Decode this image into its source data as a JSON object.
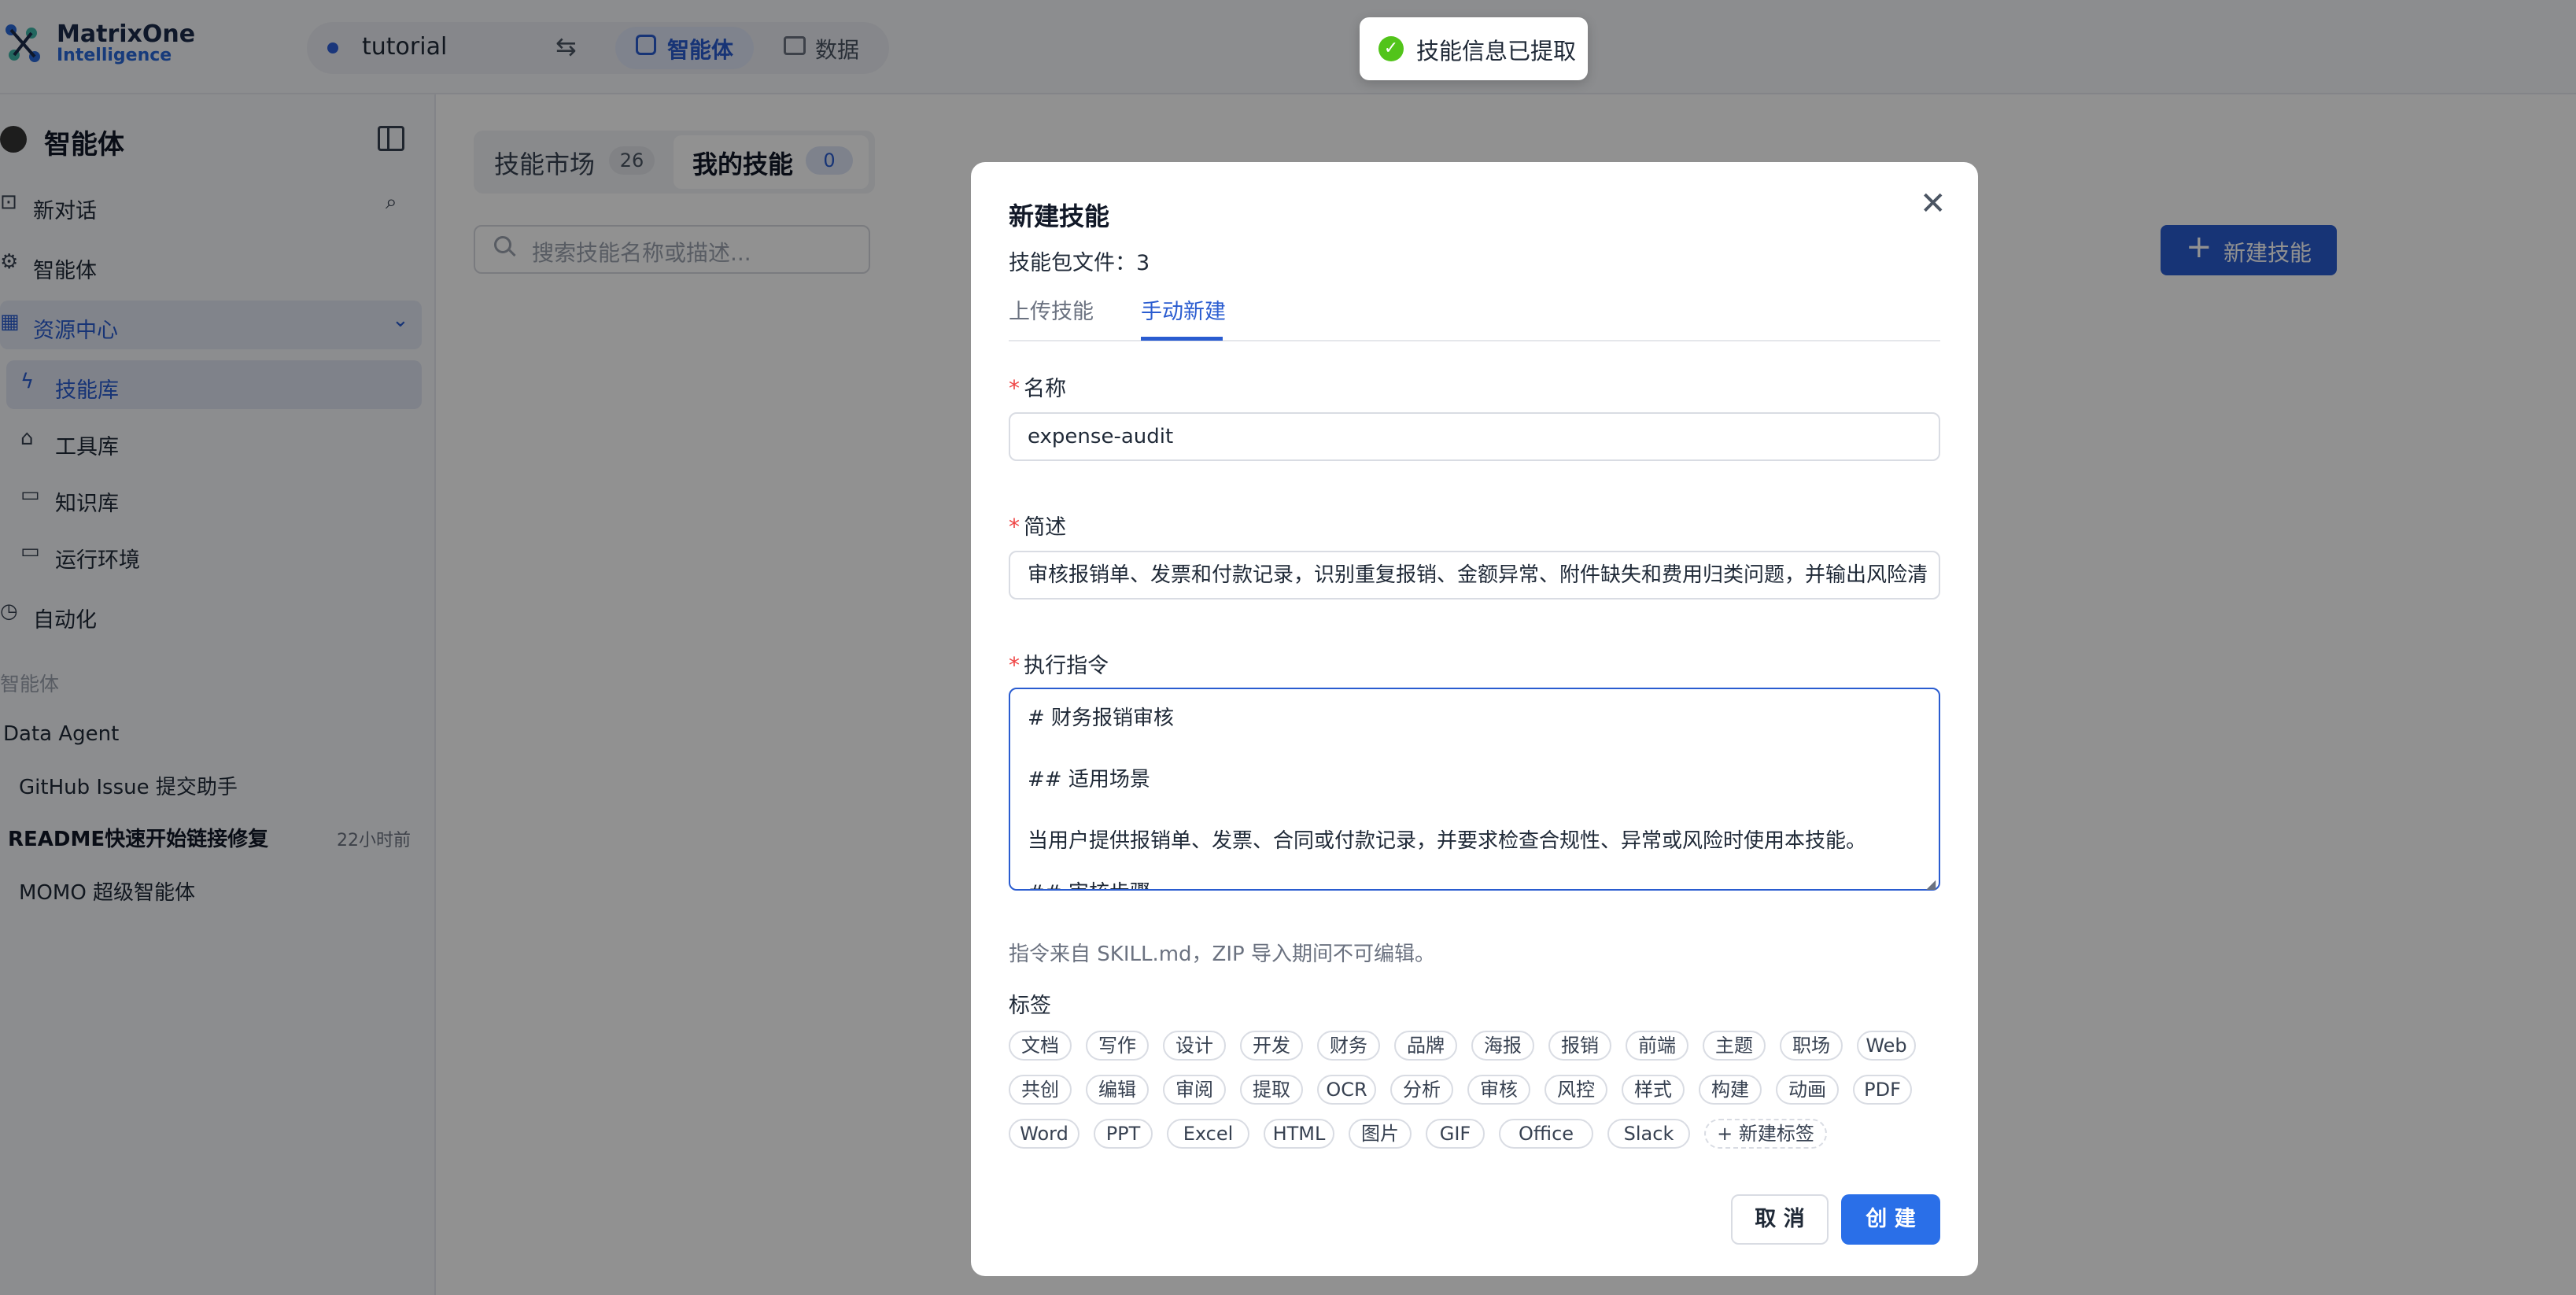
{
  "header": {
    "logo_line1": "MatrixOne",
    "logo_line2": "Intelligence",
    "workspace": "tutorial",
    "nav_agent": "智能体",
    "nav_data": "数据"
  },
  "sidebar": {
    "title": "智能体",
    "items": [
      "新对话",
      "智能体",
      "资源中心",
      "技能库",
      "工具库",
      "知识库",
      "运行环境",
      "自动化"
    ],
    "section_label": "智能体",
    "groups": [
      "Data Agent",
      "GitHub Issue 提交助手",
      "MOMO 超级智能体"
    ],
    "recent_title": "README快速开始链接修复",
    "recent_time": "22小时前"
  },
  "main": {
    "tab_market": "技能市场",
    "tab_market_count": "26",
    "tab_mine": "我的技能",
    "tab_mine_count": "0",
    "search_placeholder": "搜索技能名称或描述...",
    "new_skill_button": "新建技能"
  },
  "toast": {
    "text": "技能信息已提取"
  },
  "modal": {
    "title": "新建技能",
    "files_label": "技能包文件：3",
    "tab_upload": "上传技能",
    "tab_manual": "手动新建",
    "name_label": "名称",
    "name_value": "expense-audit",
    "desc_label": "简述",
    "desc_value": "审核报销单、发票和付款记录，识别重复报销、金额异常、附件缺失和费用归类问题，并输出风险清",
    "inst_label": "执行指令",
    "inst_lines": [
      "# 财务报销审核",
      "## 适用场景",
      "当用户提供报销单、发票、合同或付款记录，并要求检查合规性、异常或风险时使用本技能。",
      "## 审核步骤"
    ],
    "inst_note": "指令来自 SKILL.md，ZIP 导入期间不可编辑。",
    "tags_label": "标签",
    "tags_row1": [
      "文档",
      "写作",
      "设计",
      "开发",
      "财务",
      "品牌",
      "海报",
      "报销",
      "前端",
      "主题",
      "职场",
      "Web"
    ],
    "tags_row2": [
      "共创",
      "编辑",
      "审阅",
      "提取",
      "OCR",
      "分析",
      "审核",
      "风控",
      "样式",
      "构建",
      "动画",
      "PDF"
    ],
    "tags_row3": [
      "Word",
      "PPT",
      "Excel",
      "HTML",
      "图片",
      "GIF",
      "Office",
      "Slack"
    ],
    "new_tag": "+ 新建标签",
    "cancel": "取 消",
    "create": "创 建"
  }
}
